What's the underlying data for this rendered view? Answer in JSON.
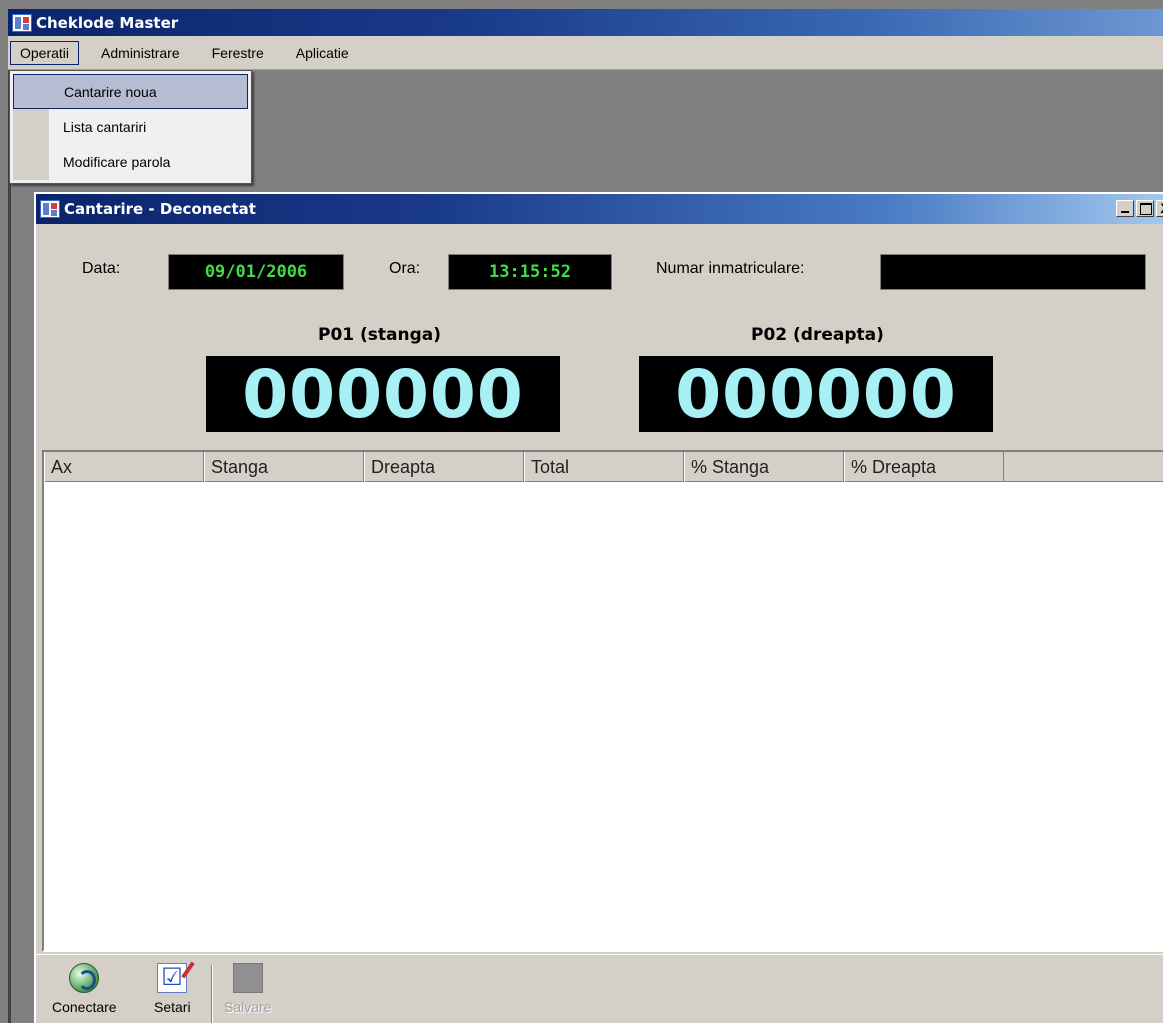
{
  "app": {
    "title": "Cheklode Master"
  },
  "menubar": {
    "items": [
      "Operatii",
      "Administrare",
      "Ferestre",
      "Aplicatie"
    ]
  },
  "dropdown": {
    "items": [
      "Cantarire noua",
      "Lista cantariri",
      "Modificare parola"
    ],
    "selected": "Cantarire noua"
  },
  "child": {
    "title": "Cantarire - Deconectat",
    "close_glyph": "X",
    "date_label": "Data:",
    "date_value": "09/01/2006",
    "time_label": "Ora:",
    "time_value": "13:15:52",
    "plate_label": "Numar inmatriculare:",
    "plate_value": "",
    "scale_left": {
      "title": "P01 (stanga)",
      "value": "000000"
    },
    "scale_right": {
      "title": "P02 (dreapta)",
      "value": "000000"
    },
    "columns": [
      "Ax",
      "Stanga",
      "Dreapta",
      "Total",
      "% Stanga",
      "% Dreapta"
    ],
    "rows": []
  },
  "toolbar": {
    "connect": "Conectare",
    "settings": "Setari",
    "save": "Salvare"
  },
  "colors": {
    "lcd_green": "#44d94a",
    "display_cyan": "#a7f0f4",
    "titlebar_blue": "#0a246a"
  }
}
